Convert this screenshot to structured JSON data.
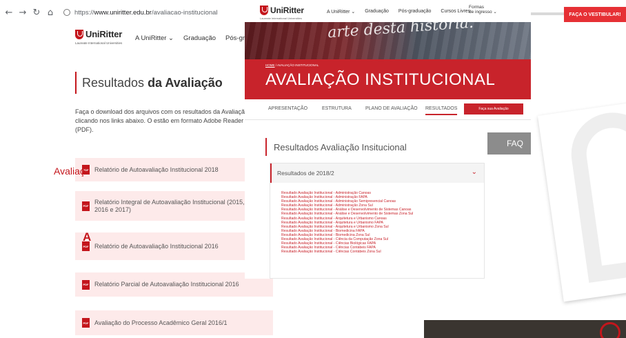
{
  "background_page": {
    "browser": {
      "url_prefix": "https://",
      "url_host": "www.uniritter.edu.br",
      "url_path": "/avaliacao-institucional"
    },
    "header": {
      "logo": "UniRitter",
      "logo_sub": "Laureate International Universities",
      "nav": [
        "A UniRitter ⌄",
        "Graduação",
        "Pós-graduação",
        "C"
      ]
    },
    "title_light": "Resultados",
    "title_bold": "da Avaliação",
    "description": "Faça o download dos arquivos com os resultados da Avaliação clicando nos links abaixo. O estão em formato Adobe Reader (PDF).",
    "pdf_icon_label": "PDF",
    "files": [
      "Relatório de Autoavaliação Institucional 2018",
      "Relatório Integral de Autoavaliação Institucional (2015, 2016 e 2017)",
      "Relatório de Autoavaliação Institucional 2016",
      "Relatório Parcial de Autoavaliação Institucional 2016",
      "Avaliação do Processo Acadêmico Geral 2016/1"
    ]
  },
  "overlay_page": {
    "logo": "UniRitter",
    "logo_sub": "Laureate International Universities",
    "menu": [
      "A UniRitter ⌄",
      "Graduação",
      "Pós-graduação",
      "Cursos Livres"
    ],
    "formas_line1": "Formas",
    "formas_line2": "de ingresso ⌄",
    "slogan": "arte desta história.",
    "breadcrumb_home": "HOME",
    "breadcrumb_sep": " / ",
    "breadcrumb_current": "AVALIAÇÃO INSTITUCIONAL",
    "page_title": "AVALIAÇÃO INSTITUCIONAL",
    "tabs": [
      "APRESENTAÇÃO",
      "ESTRUTURA",
      "PLANO DE AVALIAÇÃO",
      "RESULTADOS"
    ],
    "active_tab": "RESULTADOS",
    "cta": "Faça sua Avaliação",
    "section_title": "Resultados Avaliação Insitucional",
    "faq_label": "FAQ",
    "accordion_title": "Resultados de 2018/2",
    "accordion_chevron": "⌄",
    "links": [
      "Resultado Avaliação Institucional - Administração Canoas",
      "Resultado Avaliação Institucional - Administração FAPA",
      "Resultado Avaliação Institucional - Administração Semipresencial Canoas",
      "Resultado Avaliação Institucional - Administração Zona Sul",
      "Resultado Avaliação Institucional - Análise e Desenvolvimento de Sistemas Canoas",
      "Resultado Avaliação Institucional - Análise e Desenvolvimento de Sistemas Zona Sul",
      "Resultado Avaliação Institucional - Arquitetura e Urbanismo Canoas",
      "Resultado Avaliação Institucional - Arquitetura e Urbanismo FAPA",
      "Resultado Avaliação Institucional - Arquitetura e Urbanismo Zona Sul",
      "Resultado Avaliação Institucional - Biomedicina FAPA",
      "Resultado Avaliação Institucional - Biomedicina Zona Sul",
      "Resultado Avaliação Institucional - Ciência da Computação Zona Sul",
      "Resultado Avaliação Institucional - Ciências Biológicas FAPA",
      "Resultado Avaliação Institucional - Ciências Contábeis FAPA",
      "Resultado Avaliação Institucional - Ciências Contábeis Zona Sul"
    ]
  },
  "right_page": {
    "cta": "FAÇA O VESTIBULAR!",
    "card_text": "Avaliaç",
    "card_letter": "A"
  },
  "colors": {
    "brand_red": "#c8232b",
    "pdf_row_bg": "#fdeaea"
  },
  "icons": {
    "back": "arrow-left-icon",
    "forward": "arrow-right-icon",
    "reload": "reload-icon",
    "home": "home-icon",
    "site_info": "globe-icon",
    "pdf": "pdf-file-icon",
    "chevron": "chevron-down-icon"
  }
}
